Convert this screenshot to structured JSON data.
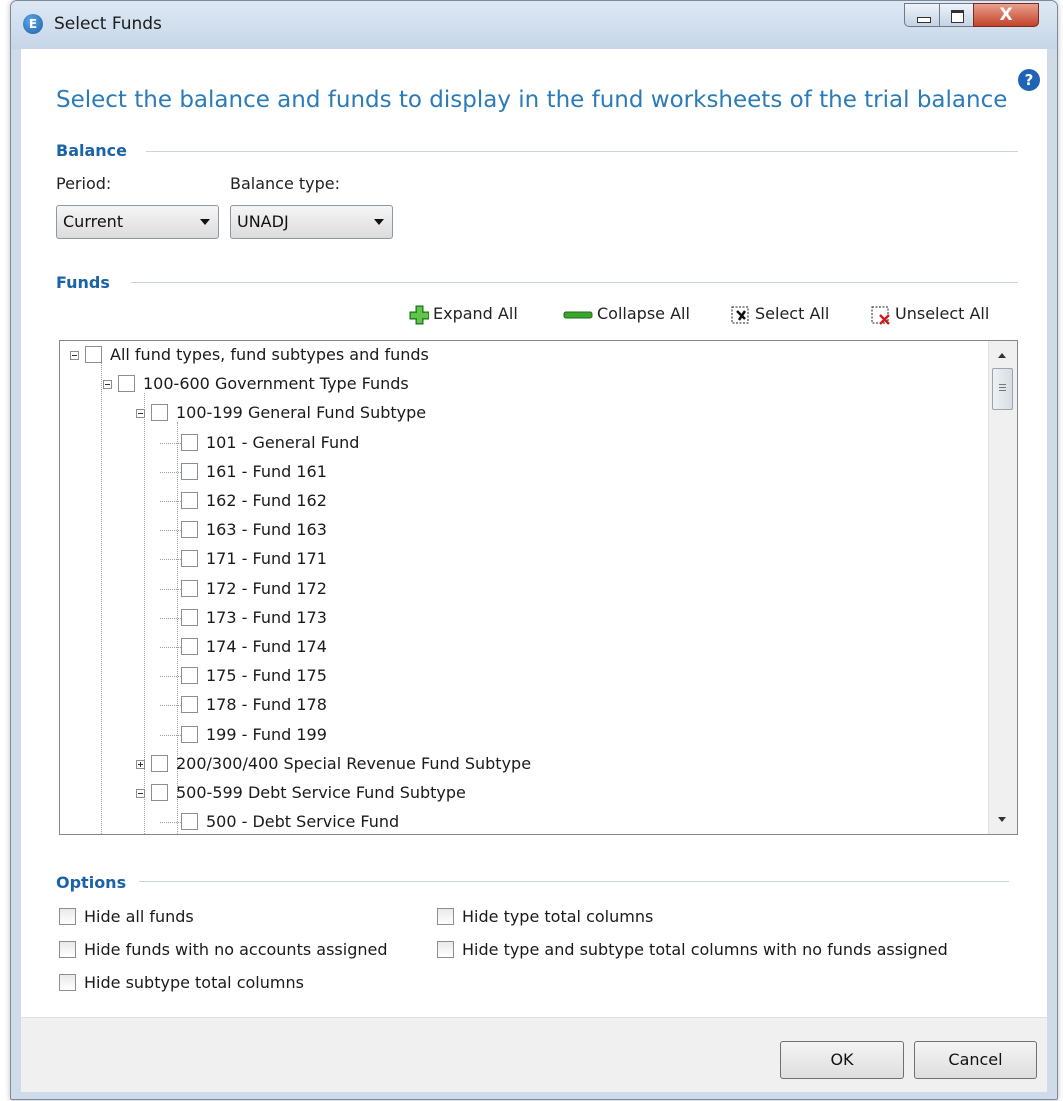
{
  "window": {
    "title": "Select Funds",
    "app_icon_letter": "E"
  },
  "caption_buttons": {
    "close_glyph": "X"
  },
  "heading": "Select the balance and funds to display in the fund worksheets of the trial balance",
  "help_glyph": "?",
  "balance": {
    "section_label": "Balance",
    "period_label": "Period:",
    "period_value": "Current",
    "balance_type_label": "Balance type:",
    "balance_type_value": "UNADJ"
  },
  "funds": {
    "section_label": "Funds",
    "toolbar": {
      "expand_all": "Expand All",
      "collapse_all": "Collapse All",
      "select_all": "Select All",
      "unselect_all": "Unselect All"
    },
    "tree": [
      {
        "label": "All fund types, fund subtypes and funds",
        "level": 0,
        "toggle": "minus",
        "checked": false
      },
      {
        "label": "100-600 Government Type Funds",
        "level": 1,
        "toggle": "minus",
        "checked": false
      },
      {
        "label": "100-199 General Fund Subtype",
        "level": 2,
        "toggle": "minus",
        "checked": false
      },
      {
        "label": "101 - General Fund",
        "level": 3,
        "toggle": "none",
        "checked": false
      },
      {
        "label": "161 - Fund 161",
        "level": 3,
        "toggle": "none",
        "checked": false
      },
      {
        "label": "162 - Fund 162",
        "level": 3,
        "toggle": "none",
        "checked": false
      },
      {
        "label": "163 - Fund 163",
        "level": 3,
        "toggle": "none",
        "checked": false
      },
      {
        "label": "171 - Fund 171",
        "level": 3,
        "toggle": "none",
        "checked": false
      },
      {
        "label": "172 - Fund 172",
        "level": 3,
        "toggle": "none",
        "checked": false
      },
      {
        "label": "173 - Fund 173",
        "level": 3,
        "toggle": "none",
        "checked": false
      },
      {
        "label": "174 - Fund 174",
        "level": 3,
        "toggle": "none",
        "checked": false
      },
      {
        "label": "175 - Fund 175",
        "level": 3,
        "toggle": "none",
        "checked": false
      },
      {
        "label": "178 - Fund 178",
        "level": 3,
        "toggle": "none",
        "checked": false
      },
      {
        "label": "199 - Fund 199",
        "level": 3,
        "toggle": "none",
        "checked": false
      },
      {
        "label": "200/300/400 Special Revenue Fund Subtype",
        "level": 2,
        "toggle": "plus",
        "checked": false
      },
      {
        "label": "500-599 Debt Service Fund Subtype",
        "level": 2,
        "toggle": "minus",
        "checked": false
      },
      {
        "label": "500 - Debt Service Fund",
        "level": 3,
        "toggle": "none",
        "checked": false
      }
    ]
  },
  "options": {
    "section_label": "Options",
    "hide_all_funds": "Hide all funds",
    "hide_funds_no_accounts": "Hide funds with no accounts assigned",
    "hide_subtype_totals": "Hide subtype total columns",
    "hide_type_totals": "Hide type total columns",
    "hide_type_subtype_no_funds": "Hide type and subtype total columns with no funds assigned"
  },
  "buttons": {
    "ok": "OK",
    "cancel": "Cancel"
  }
}
